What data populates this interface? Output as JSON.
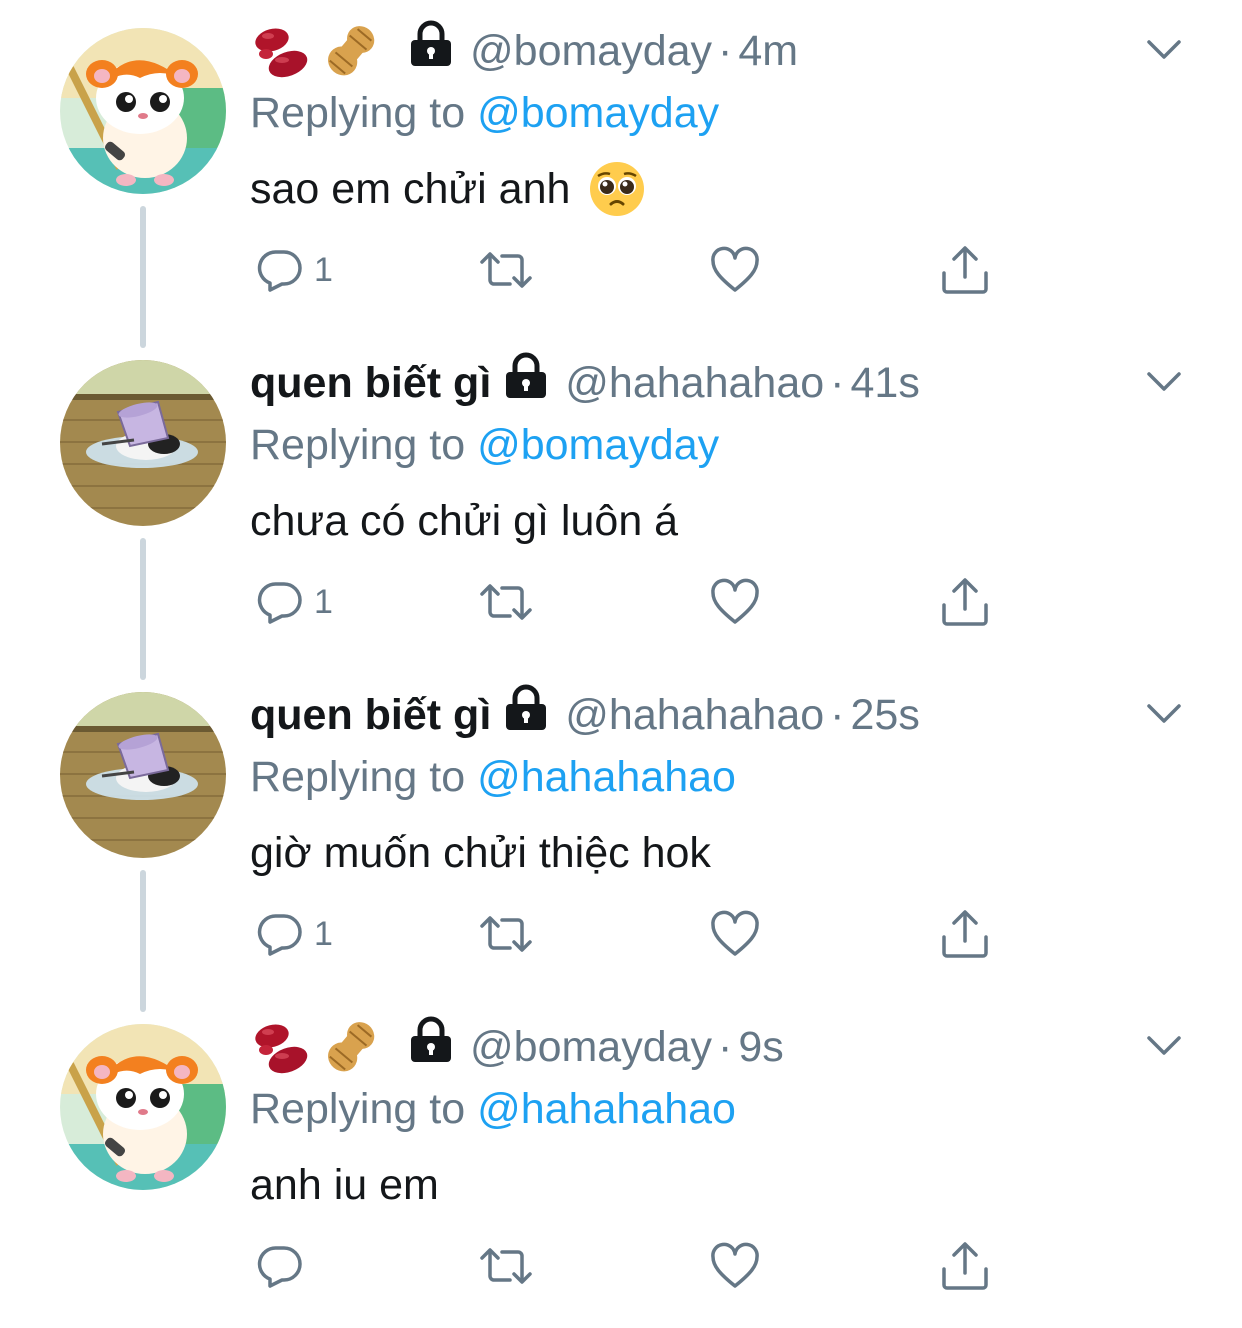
{
  "tweets": [
    {
      "name": "",
      "name_emojis": [
        "beans",
        "peanut"
      ],
      "handle": "@bomayday",
      "dot": "·",
      "time": "4m",
      "replying_prefix": "Replying to ",
      "replying_to": "@bomayday",
      "text": "sao em chửi anh",
      "text_emoji": "pleading-face",
      "reply_count": "1",
      "avatar": "hamtaro"
    },
    {
      "name": "quen biết gì",
      "name_emojis": [],
      "handle": "@hahahahao",
      "dot": "·",
      "time": "41s",
      "replying_prefix": "Replying to ",
      "replying_to": "@bomayday",
      "text": "chưa có chửi gì luôn á",
      "text_emoji": "",
      "reply_count": "1",
      "avatar": "cat-bucket"
    },
    {
      "name": "quen biết gì",
      "name_emojis": [],
      "handle": "@hahahahao",
      "dot": "·",
      "time": "25s",
      "replying_prefix": "Replying to ",
      "replying_to": "@hahahahao",
      "text": "giờ muốn chửi thiệc hok",
      "text_emoji": "",
      "reply_count": "1",
      "avatar": "cat-bucket"
    },
    {
      "name": "",
      "name_emojis": [
        "beans",
        "peanut"
      ],
      "handle": "@bomayday",
      "dot": "·",
      "time": "9s",
      "replying_prefix": "Replying to ",
      "replying_to": "@hahahahao",
      "text": "anh iu em",
      "text_emoji": "",
      "reply_count": "",
      "avatar": "hamtaro"
    }
  ],
  "colors": {
    "text": "#14171a",
    "secondary": "#657786",
    "link": "#1da1f2",
    "thread_line": "#ccd6dd"
  },
  "icons": {
    "lock": "lock-icon",
    "chevron": "chevron-down-icon",
    "reply": "reply-icon",
    "retweet": "retweet-icon",
    "like": "heart-icon",
    "share": "share-icon"
  }
}
